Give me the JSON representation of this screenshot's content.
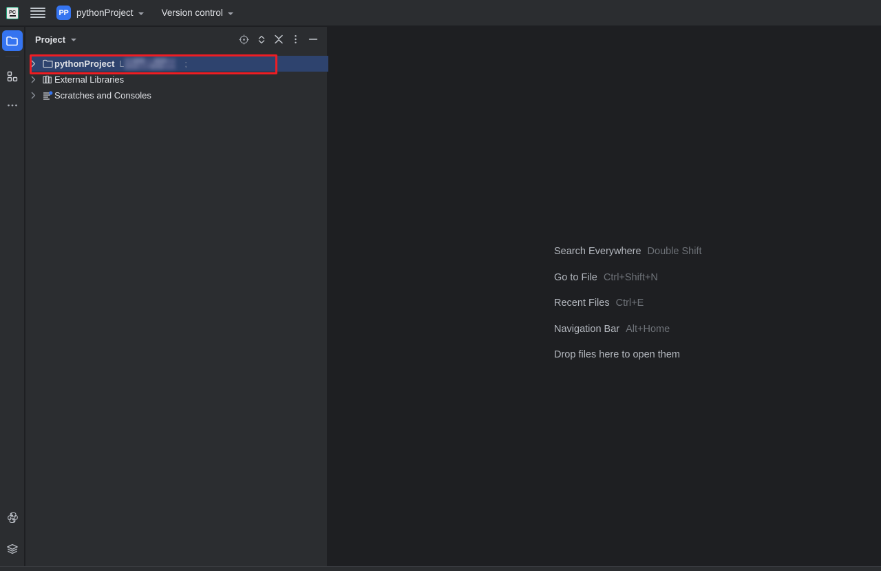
{
  "titlebar": {
    "app_icon": "pycharm-logo-icon",
    "app_icon_text": "PC",
    "menu_icon": "hamburger-menu-icon",
    "project_badge": "PP",
    "project_name": "pythonProject",
    "vcs_label": "Version control"
  },
  "activitybar": {
    "top_items": [
      {
        "name": "project",
        "icon": "folder-icon",
        "active": true
      },
      {
        "name": "structure",
        "icon": "structure-icon",
        "active": false
      },
      {
        "name": "more-tool-windows",
        "icon": "ellipsis-icon",
        "active": false
      }
    ],
    "bottom_items": [
      {
        "name": "python-console",
        "icon": "python-icon"
      },
      {
        "name": "services",
        "icon": "layers-icon"
      }
    ]
  },
  "toolwindow": {
    "title": "Project",
    "actions": [
      {
        "name": "select-opened-file",
        "icon": "crosshair-target-icon"
      },
      {
        "name": "expand-collapse",
        "icon": "chevron-up-down-icon"
      },
      {
        "name": "collapse-all",
        "icon": "collapse-all-icon"
      },
      {
        "name": "options",
        "icon": "vertical-dots-icon"
      },
      {
        "name": "hide",
        "icon": "minimize-icon"
      }
    ],
    "tree": [
      {
        "label": "pythonProject",
        "icon": "folder-icon",
        "bold": true,
        "selected": true,
        "expanded": false,
        "path_prefix": "L",
        "path_redacted": true,
        "path_tail": ";"
      },
      {
        "label": "External Libraries",
        "icon": "library-books-icon",
        "bold": false,
        "selected": false,
        "expanded": false
      },
      {
        "label": "Scratches and Consoles",
        "icon": "scratches-icon",
        "bold": false,
        "selected": false,
        "expanded": false
      }
    ]
  },
  "editor": {
    "hints": [
      {
        "action": "Search Everywhere",
        "shortcut": "Double Shift"
      },
      {
        "action": "Go to File",
        "shortcut": "Ctrl+Shift+N"
      },
      {
        "action": "Recent Files",
        "shortcut": "Ctrl+E"
      },
      {
        "action": "Navigation Bar",
        "shortcut": "Alt+Home"
      }
    ],
    "drop_hint": "Drop files here to open them"
  },
  "annotation": {
    "highlight_color": "#ee1d24",
    "target": "pythonProject tree row"
  },
  "colors": {
    "panel_bg": "#2b2d30",
    "editor_bg": "#1e1f22",
    "selection": "#2e436e",
    "accent": "#3574f0",
    "text": "#dfe1e5",
    "muted_text": "#6e7278"
  }
}
